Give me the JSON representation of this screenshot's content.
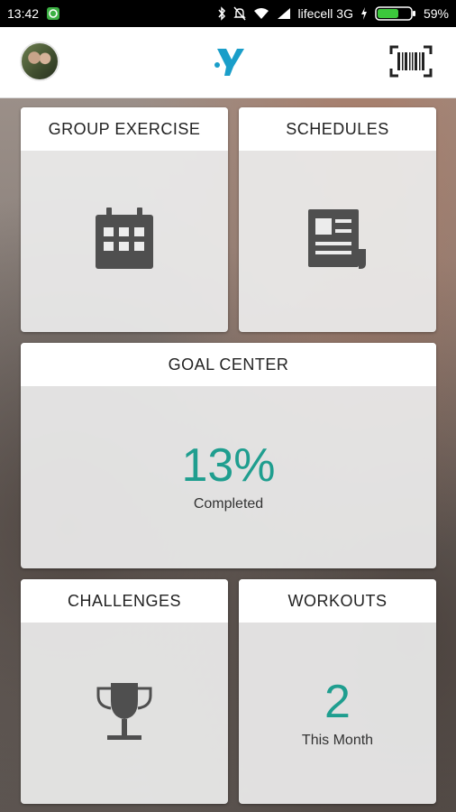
{
  "status_bar": {
    "time": "13:42",
    "carrier": "lifecell 3G",
    "battery": "59%"
  },
  "app_bar": {
    "profile_icon": "avatar",
    "logo_icon": "ymca-logo-icon",
    "scan_icon": "barcode-icon"
  },
  "cards": {
    "group_exercise": {
      "title": "GROUP EXERCISE",
      "icon": "calendar-icon"
    },
    "schedules": {
      "title": "SCHEDULES",
      "icon": "document-icon"
    },
    "goal_center": {
      "title": "GOAL CENTER",
      "value": "13%",
      "caption": "Completed"
    },
    "challenges": {
      "title": "CHALLENGES",
      "icon": "trophy-icon"
    },
    "workouts": {
      "title": "WORKOUTS",
      "value": "2",
      "caption": "This Month"
    }
  },
  "colors": {
    "accent": "#1f9e8f",
    "icon": "#4f4f4f",
    "logo": "#1a9ec9"
  }
}
